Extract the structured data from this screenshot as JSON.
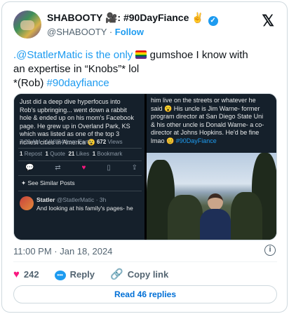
{
  "author": {
    "display_name": "SHABOOTY 🎥: #90DayFiance ✌",
    "handle": "@SHABOOTY",
    "follow_label": "Follow"
  },
  "tweet": {
    "line1_a": ".@StatlerMatic is the only",
    "line1_b": "gumshoe I know with",
    "line2": "an expertise in “Knobs”* lol",
    "line3_a": "*(Rob)",
    "line3_b": "#90dayfiance"
  },
  "left_shot": {
    "lines": [
      "Just did a deep dive hyperfocus into",
      "Rob's upbringing... went down a rabbit",
      "hole & ended up on his mom's Facebook",
      "page. He grew up in Overland Park, KS",
      "which was listed as one of the top 3",
      "richest cities in America 😮"
    ],
    "meta": "7:02 AM · 1/18/24 from Earth ·",
    "views": "672",
    "views_label": "Views",
    "stats": [
      {
        "n": "1",
        "label": "Repost"
      },
      {
        "n": "1",
        "label": "Quote"
      },
      {
        "n": "21",
        "label": "Likes"
      },
      {
        "n": "1",
        "label": "Bookmark"
      }
    ],
    "see_similar": "See Similar Posts",
    "reply_name": "Statler",
    "reply_handle": "@StatlerMatic · 3h",
    "reply_text": "And looking at his family's pages- he"
  },
  "right_shot": {
    "lines": [
      "him live on the streets or whatever he",
      "said 😮 His uncle is Jim Warne- former",
      "program director at San Diego State Uni",
      "& his other uncle is Donald Warne- a co-",
      "director at Johns Hopkins. He'd be fine"
    ],
    "last_a": "lmao 😊",
    "last_b": "#90DayFiance"
  },
  "timestamp": "11:00 PM · Jan 18, 2024",
  "actions": {
    "likes": "242",
    "reply_label": "Reply",
    "copy_label": "Copy link"
  },
  "read_replies": "Read 46 replies",
  "colors": {
    "accent": "#1d9bf0",
    "like": "#f91880",
    "dark_bg": "#15202b"
  }
}
